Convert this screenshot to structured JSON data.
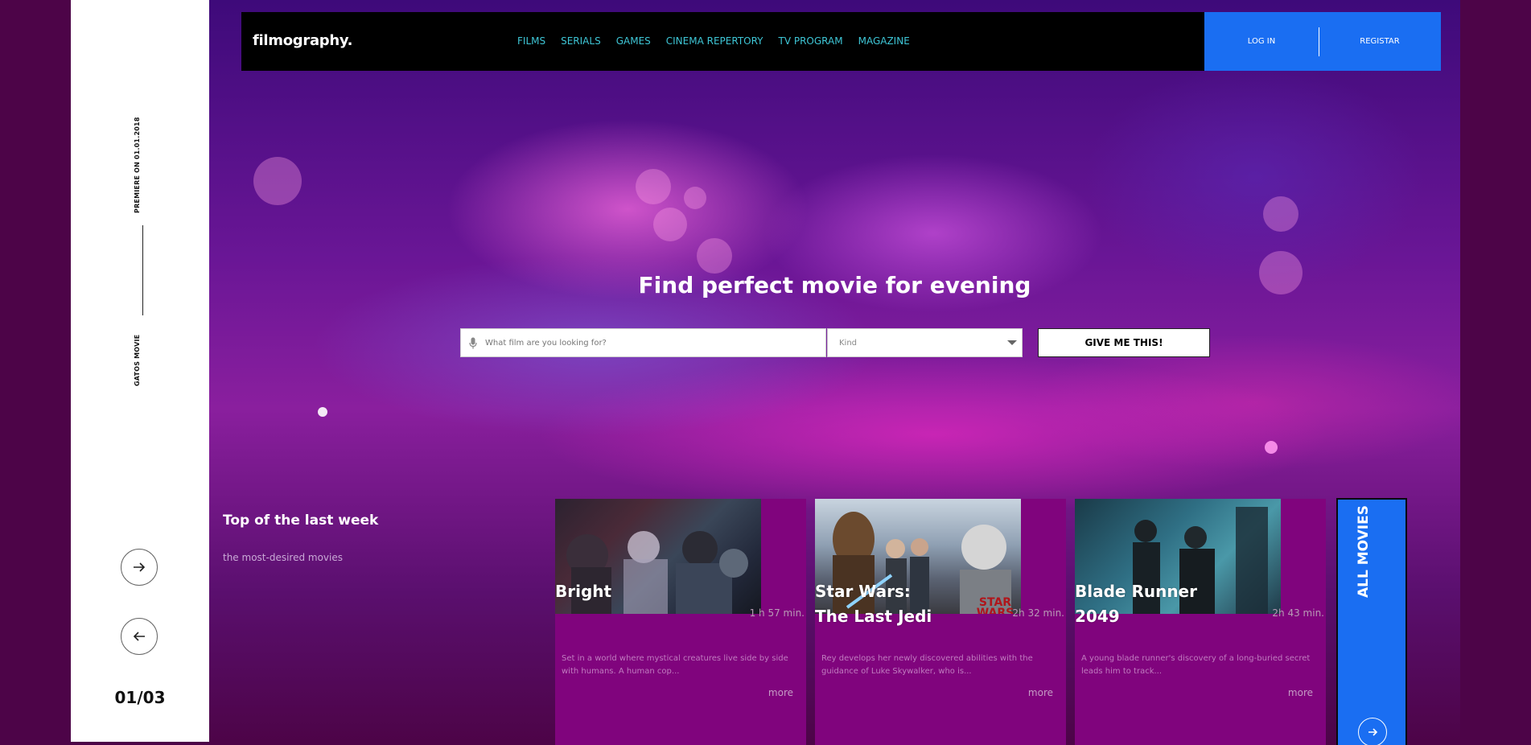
{
  "sidebar": {
    "premiere_text": "PREMIERE ON 01.01.2018",
    "movie_name": "GATOS MOVIE",
    "counter": "01/03"
  },
  "navbar": {
    "logo": "filmography.",
    "links": [
      "FILMS",
      "SERIALS",
      "GAMES",
      "CINEMA REPERTORY",
      "TV PROGRAM",
      "MAGAZINE"
    ],
    "login_label": "LOG IN",
    "register_label": "REGISTAR"
  },
  "hero": {
    "title": "Find perfect movie for evening",
    "search_placeholder": "What film are you looking for?",
    "kind_label": "Kind",
    "submit_label": "GIVE ME THIS!"
  },
  "top_week": {
    "title": "Top of the last week",
    "subtitle": "the most-desired movies",
    "all_movies_label": "ALL MOVIES",
    "cards": [
      {
        "title_line1": "Bright",
        "title_line2": "",
        "duration": "1 h 57 min.",
        "description": "Set in a world where mystical creatures live side by side with humans. A human cop...",
        "more": "more"
      },
      {
        "title_line1": "Star Wars:",
        "title_line2": "The Last Jedi",
        "duration": "2h 32 min.",
        "description": "Rey develops her newly discovered abilities with the guidance of Luke Skywalker, who is...",
        "more": "more"
      },
      {
        "title_line1": "Blade Runner",
        "title_line2": "2049",
        "duration": "2h 43 min.",
        "description": "A young blade runner's discovery of a long-buried secret leads him to track...",
        "more": "more"
      }
    ]
  },
  "colors": {
    "accent_blue": "#1a6ef2",
    "nav_link": "#3ec6d6",
    "card_bg": "#80047d",
    "page_bg": "#4d0448"
  }
}
